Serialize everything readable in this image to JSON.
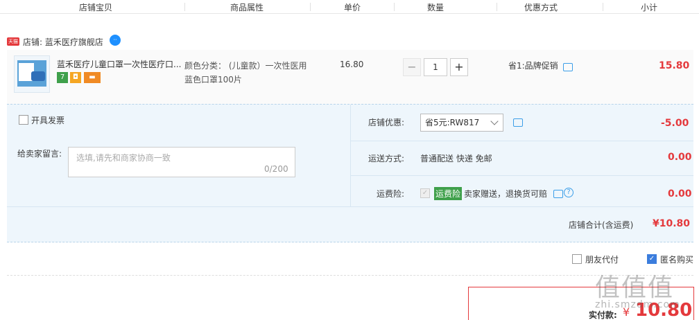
{
  "header": {
    "col_shop_item": "店铺宝贝",
    "col_attr": "商品属性",
    "col_price": "单价",
    "col_qty": "数量",
    "col_discount": "优惠方式",
    "col_subtotal": "小计"
  },
  "shop": {
    "badge": "天猫",
    "label": "店铺: 蓝禾医疗旗舰店",
    "wangwang_icon": "wangwang-chat-icon"
  },
  "item": {
    "title": "蓝禾医疗儿童口罩一次性医疗口...",
    "attr_line1": "颜色分类： (儿童款）一次性医用",
    "attr_line2": "蓝色口罩100片",
    "price": "16.80",
    "quantity": "1",
    "minus": "−",
    "plus": "+",
    "promotion": "省1:品牌促销",
    "subtotal": "15.80",
    "svc_7day": "7"
  },
  "invoice": {
    "label": "开具发票"
  },
  "message": {
    "label": "给卖家留言:",
    "placeholder": "选填,请先和商家协商一致",
    "counter": "0/200"
  },
  "shop_discount": {
    "label": "店铺优惠:",
    "selected": "省5元:RW817",
    "amount": "-5.00"
  },
  "shipping": {
    "label": "运送方式:",
    "value": "普通配送 快递 免邮",
    "amount": "0.00"
  },
  "insurance": {
    "label": "运费险:",
    "tag": "运费险",
    "value": "卖家赠送，退换货可赔",
    "amount": "0.00"
  },
  "shop_total": {
    "label": "店铺合计(含运费)",
    "amount": "¥10.80"
  },
  "options": {
    "friend_pay": "朋友代付",
    "anonymous": "匿名购买"
  },
  "pay": {
    "label": "实付款:",
    "currency": "¥",
    "amount": "10.80"
  },
  "watermark": {
    "logo": "值值值",
    "site": "zhi.smzdm.com"
  },
  "colors": {
    "price_red": "#e4393c",
    "accent_blue": "#3b7ddd",
    "green": "#3fa04b"
  }
}
